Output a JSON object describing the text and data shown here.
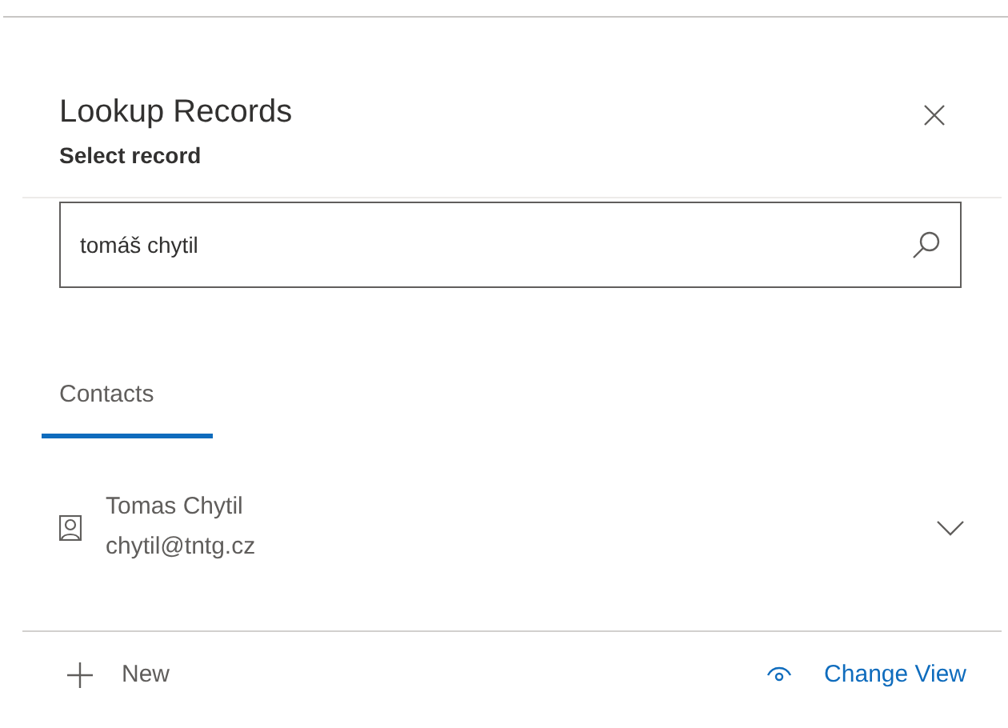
{
  "dialog": {
    "title": "Lookup Records",
    "subtitle": "Select record"
  },
  "search": {
    "value": "tomáš chytil"
  },
  "tabs": [
    {
      "label": "Contacts",
      "selected": true
    }
  ],
  "results": [
    {
      "name": "Tomas Chytil",
      "email": "chytil@tntg.cz",
      "expanded": false
    }
  ],
  "footer": {
    "new_label": "New",
    "change_view_label": "Change View"
  }
}
